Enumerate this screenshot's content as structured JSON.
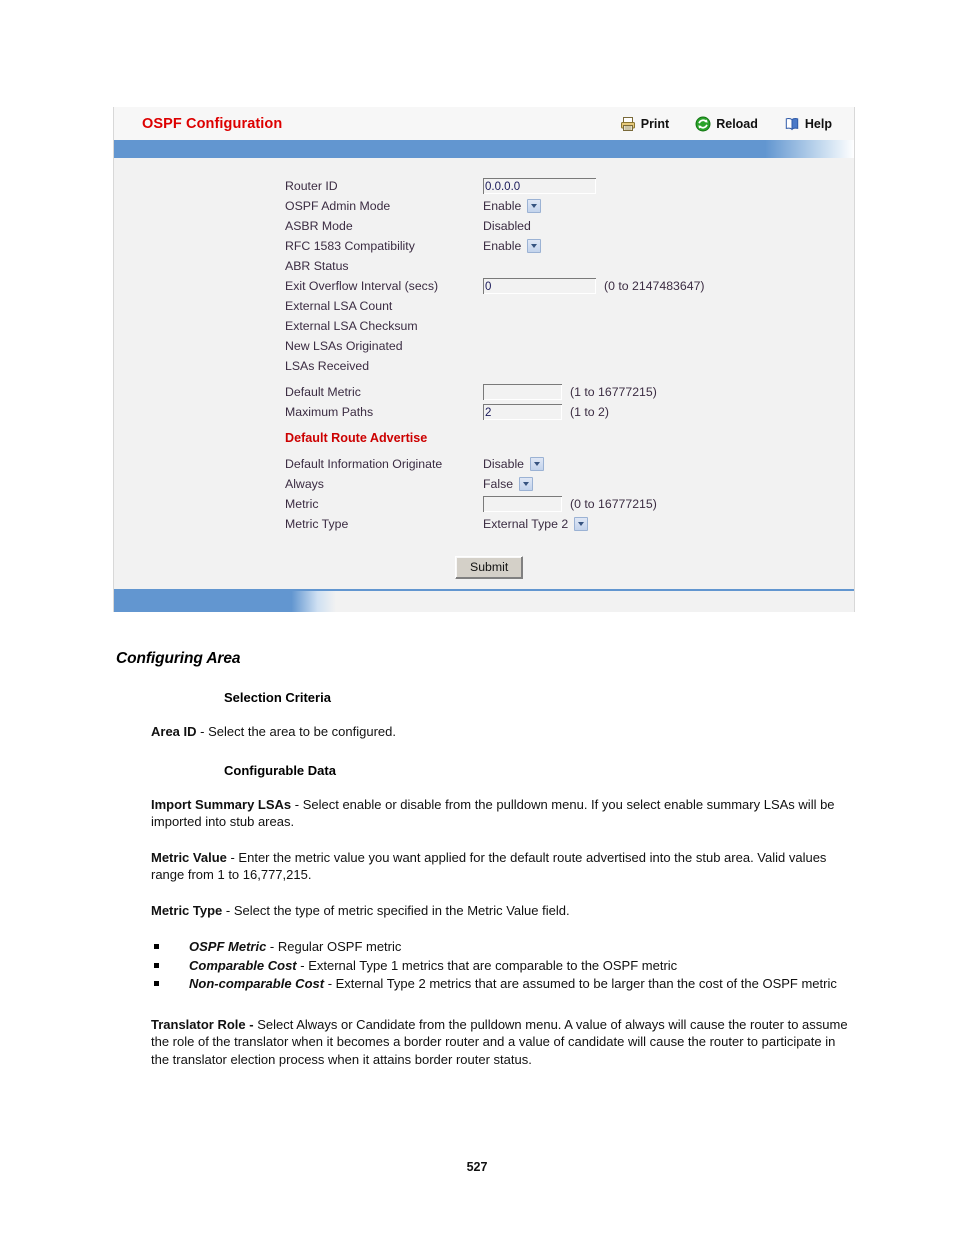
{
  "panel": {
    "title": "OSPF Configuration",
    "actions": [
      {
        "label": "Print",
        "icon": "printer-icon"
      },
      {
        "label": "Reload",
        "icon": "reload-icon"
      },
      {
        "label": "Help",
        "icon": "book-icon"
      }
    ],
    "submit_label": "Submit",
    "accent_blue": "#6296d0",
    "title_red": "#dd0000",
    "section_red": "#cc0000",
    "fields": {
      "router_id": {
        "label": "Router ID",
        "value": "0.0.0.0"
      },
      "ospf_admin_mode": {
        "label": "OSPF Admin Mode",
        "value": "Enable"
      },
      "asbr_mode": {
        "label": "ASBR Mode",
        "value": "Disabled"
      },
      "rfc_1583": {
        "label": "RFC 1583 Compatibility",
        "value": "Enable"
      },
      "abr_status": {
        "label": "ABR Status",
        "value": ""
      },
      "exit_overflow": {
        "label": "Exit Overflow Interval (secs)",
        "value": "0",
        "hint": "(0 to 2147483647)"
      },
      "external_lsa_count": {
        "label": "External LSA Count",
        "value": ""
      },
      "external_lsa_checksum": {
        "label": "External LSA Checksum",
        "value": ""
      },
      "new_lsas_originated": {
        "label": "New LSAs Originated",
        "value": ""
      },
      "lsas_received": {
        "label": "LSAs Received",
        "value": ""
      },
      "default_metric": {
        "label": "Default Metric",
        "value": "",
        "hint": "(1 to 16777215)"
      },
      "maximum_paths": {
        "label": "Maximum Paths",
        "value": "2",
        "hint": "(1 to 2)"
      },
      "section_default_route": {
        "label": "Default Route Advertise"
      },
      "default_info_originate": {
        "label": "Default Information Originate",
        "value": "Disable"
      },
      "always": {
        "label": "Always",
        "value": "False"
      },
      "metric": {
        "label": "Metric",
        "value": "",
        "hint": "(0 to 16777215)"
      },
      "metric_type": {
        "label": "Metric Type",
        "value": "External Type 2"
      }
    }
  },
  "doc": {
    "section_heading": "Configuring Area",
    "selection_criteria_heading": "Selection Criteria",
    "area_id_term": "Area ID",
    "area_id_desc": " - Select the area to be configured.",
    "configurable_data_heading": "Configurable Data",
    "import_summary_term": "Import Summary LSAs",
    "import_summary_desc": " - Select enable or disable from the pulldown menu. If you select enable summary LSAs will be imported into stub areas.",
    "metric_value_term": "Metric Value",
    "metric_value_desc": " - Enter the metric value you want applied for the default route advertised into the stub area. Valid values range from 1 to 16,777,215.",
    "metric_type_term": "Metric Type",
    "metric_type_desc": " - Select the type of metric specified in the Metric Value field.",
    "bullets": [
      {
        "term": "OSPF Metric",
        "desc": " - Regular OSPF metric"
      },
      {
        "term": "Comparable Cost",
        "desc": " - External Type 1 metrics that are comparable to the OSPF metric"
      },
      {
        "term": "Non-comparable Cost",
        "desc": " - External Type 2 metrics that are assumed to be larger than the cost of the OSPF metric"
      }
    ],
    "translator_term": "Translator Role -",
    "translator_desc": " Select Always or Candidate from the pulldown menu. A value of always will cause the router to assume the role of the translator when it becomes a border router and a value of candidate will cause the router to participate in the translator election process when it attains border router status.",
    "page_number": "527"
  }
}
